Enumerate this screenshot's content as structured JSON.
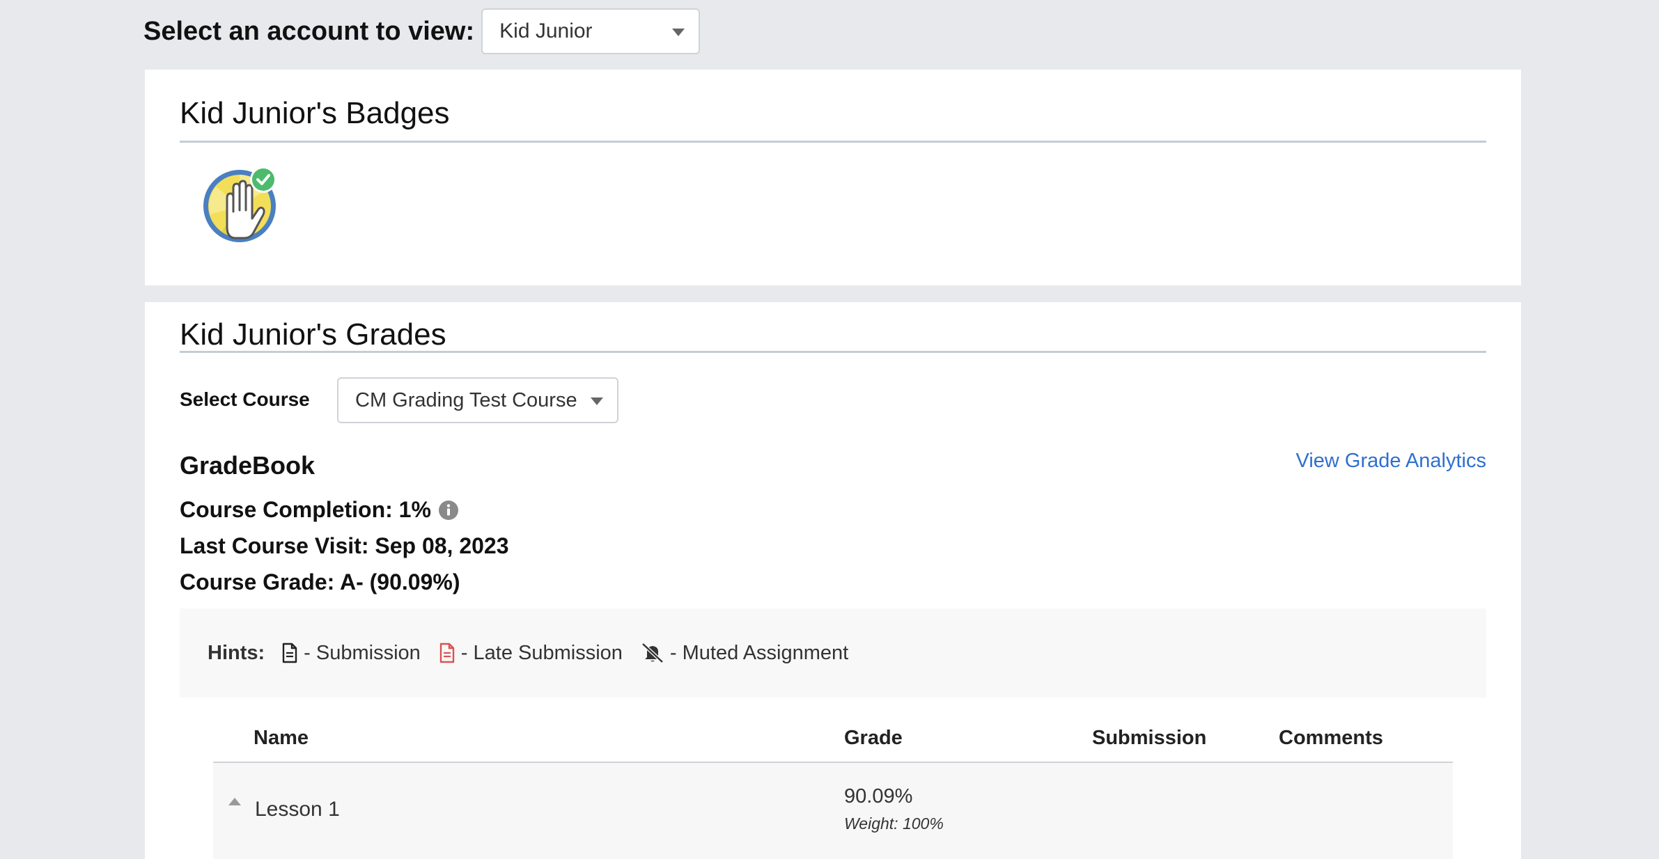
{
  "account": {
    "label": "Select an account to view:",
    "selected": "Kid Junior"
  },
  "badges": {
    "title": "Kid Junior's Badges",
    "items": [
      {
        "icon": "raised-hand-badge-icon",
        "earned": true
      }
    ]
  },
  "grades": {
    "title": "Kid Junior's Grades",
    "course_label": "Select Course",
    "course_selected": "CM Grading Test Course",
    "gradebook_title": "GradeBook",
    "analytics_link": "View Grade Analytics",
    "completion": "Course Completion: 1%",
    "last_visit": "Last Course Visit: Sep 08, 2023",
    "course_grade": "Course Grade: A- (90.09%)"
  },
  "hints": {
    "label": "Hints:",
    "items": [
      {
        "icon": "document-icon",
        "text": "- Submission"
      },
      {
        "icon": "late-document-icon",
        "text": "- Late Submission"
      },
      {
        "icon": "muted-bell-icon",
        "text": "- Muted Assignment"
      }
    ]
  },
  "table": {
    "columns": [
      "Name",
      "Grade",
      "Submission",
      "Comments"
    ],
    "rows": [
      {
        "name": "Lesson 1",
        "grade": "90.09%",
        "weight": "Weight: 100%"
      }
    ]
  },
  "colors": {
    "link": "#2f6fcf",
    "late": "#d9534f",
    "badge_ring": "#4a7fc1",
    "badge_check": "#4cbb6c"
  }
}
